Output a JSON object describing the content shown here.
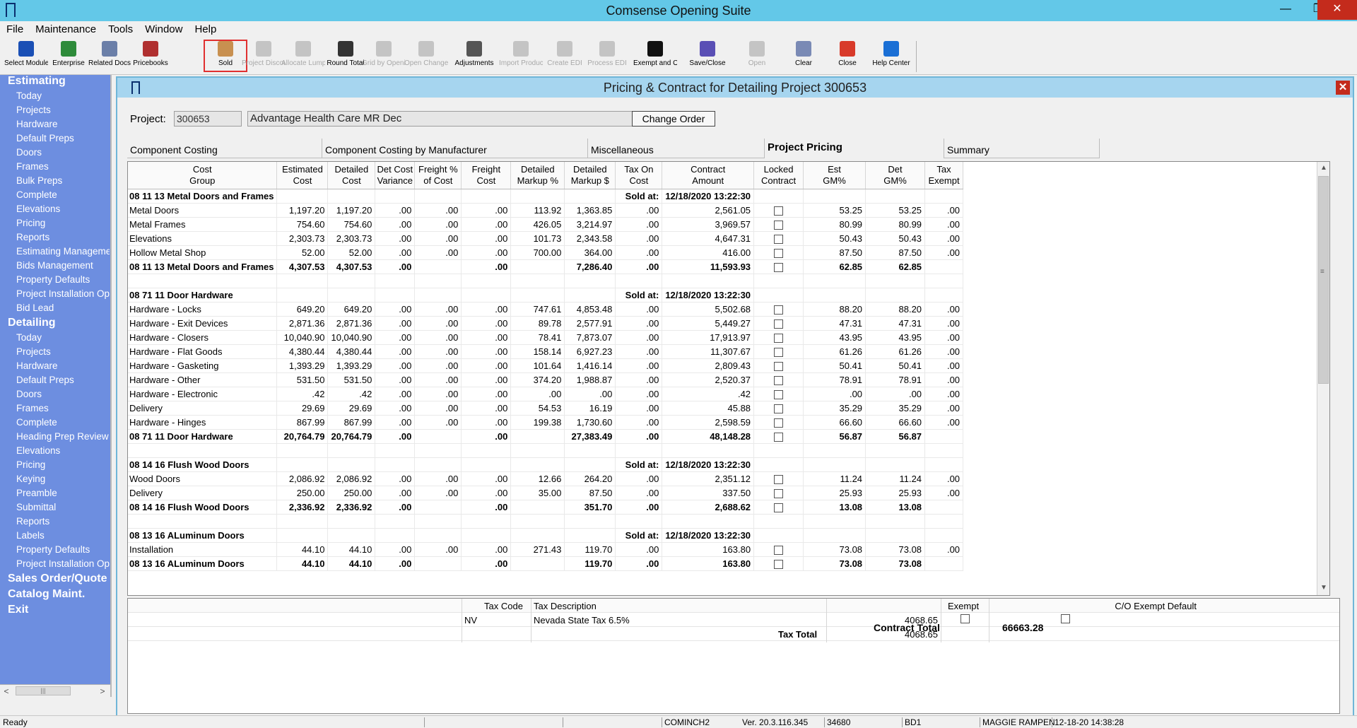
{
  "window": {
    "title": "Comsense Opening Suite"
  },
  "menu": [
    "File",
    "Maintenance",
    "Tools",
    "Window",
    "Help"
  ],
  "toolbar": [
    {
      "label": "Select Module",
      "icon": "module-icon",
      "color": "#1a4fb5",
      "enabled": true
    },
    {
      "label": "Enterprise",
      "icon": "enterprise-icon",
      "color": "#2e8b3a",
      "enabled": true
    },
    {
      "label": "Related Docs",
      "icon": "related-docs-icon",
      "color": "#6b7fa8",
      "enabled": true
    },
    {
      "label": "Pricebooks",
      "icon": "pricebooks-icon",
      "color": "#b03030",
      "enabled": true
    },
    {
      "label": "Sold",
      "icon": "sold-icon",
      "color": "#c89050",
      "enabled": true
    },
    {
      "label": "Project Discount",
      "icon": "discount-icon",
      "color": "#8a8a8a",
      "enabled": false
    },
    {
      "label": "Allocate Lump Sum",
      "icon": "lump-sum-icon",
      "color": "#8a8a8a",
      "enabled": false
    },
    {
      "label": "Round Total",
      "icon": "round-total-icon",
      "color": "#333333",
      "enabled": true
    },
    {
      "label": "Grid by Opening",
      "icon": "binoculars-icon",
      "color": "#8a8a8a",
      "enabled": false
    },
    {
      "label": "Open Change Wizard",
      "icon": "change-icon",
      "color": "#8a8a8a",
      "enabled": false
    },
    {
      "label": "Adjustments",
      "icon": "adjustments-icon",
      "color": "#555555",
      "enabled": true
    },
    {
      "label": "Import Products",
      "icon": "import-icon",
      "color": "#8a8a8a",
      "enabled": false
    },
    {
      "label": "Create EDI",
      "icon": "create-edi-icon",
      "color": "#8a8a8a",
      "enabled": false
    },
    {
      "label": "Process EDI",
      "icon": "process-edi-icon",
      "color": "#8a8a8a",
      "enabled": false
    },
    {
      "label": "Exempt and Or",
      "icon": "percent-icon",
      "color": "#111111",
      "enabled": true
    },
    {
      "label": "Save/Close",
      "icon": "save-icon",
      "color": "#5a4fb5",
      "enabled": true
    },
    {
      "label": "Open",
      "icon": "open-folder-icon",
      "color": "#8a8a8a",
      "enabled": false
    },
    {
      "label": "Clear",
      "icon": "eraser-icon",
      "color": "#7a8ab5",
      "enabled": true
    },
    {
      "label": "Close",
      "icon": "close-icon",
      "color": "#d83a2a",
      "enabled": true
    },
    {
      "label": "Help Center",
      "icon": "help-icon",
      "color": "#1a6fd5",
      "enabled": true
    }
  ],
  "nav": {
    "sections": [
      {
        "title": "Estimating",
        "items": [
          "Today",
          "Projects",
          "Hardware",
          "Default Preps",
          "Doors",
          "Frames",
          "Bulk Preps",
          "Complete",
          "Elevations",
          "Pricing",
          "Reports",
          "Estimating Management",
          "Bids Management",
          "Property Defaults",
          "Project Installation Options",
          "Bid Lead"
        ]
      },
      {
        "title": "Detailing",
        "items": [
          "Today",
          "Projects",
          "Hardware",
          "Default Preps",
          "Doors",
          "Frames",
          "Complete",
          "Heading Prep Review",
          "Elevations",
          "Pricing",
          "Keying",
          "Preamble",
          "Submittal",
          "Reports",
          "Labels",
          "Property Defaults",
          "Project Installation Options"
        ]
      },
      {
        "title": "Sales Order/Quote",
        "items": []
      },
      {
        "title": "Catalog Maint.",
        "items": []
      },
      {
        "title": "Exit",
        "items": []
      }
    ]
  },
  "child": {
    "title": "Pricing & Contract for Detailing Project 300653",
    "project_label": "Project:",
    "project_number": "300653",
    "project_name": "Advantage Health Care MR Dec",
    "change_order_label": "Change Order",
    "tabs": [
      "Component Costing",
      "Component Costing by Manufacturer",
      "Miscellaneous",
      "Project Pricing",
      "Summary"
    ],
    "active_tab": "Project Pricing"
  },
  "grid": {
    "columns": [
      "Cost\nGroup",
      "Estimated\nCost",
      "Detailed\nCost",
      "Det Cost\nVariance",
      "Freight %\nof Cost",
      "Freight\nCost",
      "Detailed\nMarkup %",
      "Detailed\nMarkup $",
      "Tax On\nCost",
      "Contract\nAmount",
      "Locked\nContract",
      "Est\nGM%",
      "Det\nGM%",
      "Tax\nExempt"
    ],
    "rows": [
      {
        "type": "hdr",
        "cells": [
          "08 11 13 Metal Doors and Frames",
          "",
          "",
          "",
          "",
          "",
          "",
          "",
          "Sold at:",
          "12/18/2020 13:22:30",
          "",
          "",
          "",
          ""
        ]
      },
      {
        "type": "row",
        "cells": [
          "Metal Doors",
          "1,197.20",
          "1,197.20",
          ".00",
          ".00",
          ".00",
          "113.92",
          "1,363.85",
          ".00",
          "2,561.05",
          "cb",
          "53.25",
          "53.25",
          ".00"
        ]
      },
      {
        "type": "row",
        "cells": [
          "Metal Frames",
          "754.60",
          "754.60",
          ".00",
          ".00",
          ".00",
          "426.05",
          "3,214.97",
          ".00",
          "3,969.57",
          "cb",
          "80.99",
          "80.99",
          ".00"
        ]
      },
      {
        "type": "row",
        "cells": [
          "Elevations",
          "2,303.73",
          "2,303.73",
          ".00",
          ".00",
          ".00",
          "101.73",
          "2,343.58",
          ".00",
          "4,647.31",
          "cb",
          "50.43",
          "50.43",
          ".00"
        ]
      },
      {
        "type": "row",
        "cells": [
          "Hollow Metal Shop",
          "52.00",
          "52.00",
          ".00",
          ".00",
          ".00",
          "700.00",
          "364.00",
          ".00",
          "416.00",
          "cb",
          "87.50",
          "87.50",
          ".00"
        ]
      },
      {
        "type": "bold",
        "cells": [
          "08 11 13 Metal Doors and Frames",
          "4,307.53",
          "4,307.53",
          ".00",
          "",
          ".00",
          "",
          "7,286.40",
          ".00",
          "11,593.93",
          "cb",
          "62.85",
          "62.85",
          ""
        ]
      },
      {
        "type": "blank",
        "cells": []
      },
      {
        "type": "hdr",
        "cells": [
          "08 71 11 Door Hardware",
          "",
          "",
          "",
          "",
          "",
          "",
          "",
          "Sold at:",
          "12/18/2020 13:22:30",
          "",
          "",
          "",
          ""
        ]
      },
      {
        "type": "row",
        "cells": [
          "Hardware - Locks",
          "649.20",
          "649.20",
          ".00",
          ".00",
          ".00",
          "747.61",
          "4,853.48",
          ".00",
          "5,502.68",
          "cb",
          "88.20",
          "88.20",
          ".00"
        ]
      },
      {
        "type": "row",
        "cells": [
          "Hardware - Exit Devices",
          "2,871.36",
          "2,871.36",
          ".00",
          ".00",
          ".00",
          "89.78",
          "2,577.91",
          ".00",
          "5,449.27",
          "cb",
          "47.31",
          "47.31",
          ".00"
        ]
      },
      {
        "type": "row",
        "cells": [
          "Hardware - Closers",
          "10,040.90",
          "10,040.90",
          ".00",
          ".00",
          ".00",
          "78.41",
          "7,873.07",
          ".00",
          "17,913.97",
          "cb",
          "43.95",
          "43.95",
          ".00"
        ]
      },
      {
        "type": "row",
        "cells": [
          "Hardware - Flat Goods",
          "4,380.44",
          "4,380.44",
          ".00",
          ".00",
          ".00",
          "158.14",
          "6,927.23",
          ".00",
          "11,307.67",
          "cb",
          "61.26",
          "61.26",
          ".00"
        ]
      },
      {
        "type": "row",
        "cells": [
          "Hardware - Gasketing",
          "1,393.29",
          "1,393.29",
          ".00",
          ".00",
          ".00",
          "101.64",
          "1,416.14",
          ".00",
          "2,809.43",
          "cb",
          "50.41",
          "50.41",
          ".00"
        ]
      },
      {
        "type": "row",
        "cells": [
          "Hardware - Other",
          "531.50",
          "531.50",
          ".00",
          ".00",
          ".00",
          "374.20",
          "1,988.87",
          ".00",
          "2,520.37",
          "cb",
          "78.91",
          "78.91",
          ".00"
        ]
      },
      {
        "type": "row",
        "cells": [
          "Hardware - Electronic",
          ".42",
          ".42",
          ".00",
          ".00",
          ".00",
          ".00",
          ".00",
          ".00",
          ".42",
          "cb",
          ".00",
          ".00",
          ".00"
        ]
      },
      {
        "type": "row",
        "cells": [
          "Delivery",
          "29.69",
          "29.69",
          ".00",
          ".00",
          ".00",
          "54.53",
          "16.19",
          ".00",
          "45.88",
          "cb",
          "35.29",
          "35.29",
          ".00"
        ]
      },
      {
        "type": "row",
        "cells": [
          "Hardware - Hinges",
          "867.99",
          "867.99",
          ".00",
          ".00",
          ".00",
          "199.38",
          "1,730.60",
          ".00",
          "2,598.59",
          "cb",
          "66.60",
          "66.60",
          ".00"
        ]
      },
      {
        "type": "bold",
        "cells": [
          "08 71 11 Door Hardware",
          "20,764.79",
          "20,764.79",
          ".00",
          "",
          ".00",
          "",
          "27,383.49",
          ".00",
          "48,148.28",
          "cb",
          "56.87",
          "56.87",
          ""
        ]
      },
      {
        "type": "blank",
        "cells": []
      },
      {
        "type": "hdr",
        "cells": [
          "08 14 16 Flush Wood Doors",
          "",
          "",
          "",
          "",
          "",
          "",
          "",
          "Sold at:",
          "12/18/2020 13:22:30",
          "",
          "",
          "",
          ""
        ]
      },
      {
        "type": "row",
        "cells": [
          "Wood Doors",
          "2,086.92",
          "2,086.92",
          ".00",
          ".00",
          ".00",
          "12.66",
          "264.20",
          ".00",
          "2,351.12",
          "cb",
          "11.24",
          "11.24",
          ".00"
        ]
      },
      {
        "type": "row",
        "cells": [
          "Delivery",
          "250.00",
          "250.00",
          ".00",
          ".00",
          ".00",
          "35.00",
          "87.50",
          ".00",
          "337.50",
          "cb",
          "25.93",
          "25.93",
          ".00"
        ]
      },
      {
        "type": "bold",
        "cells": [
          "08 14 16 Flush Wood Doors",
          "2,336.92",
          "2,336.92",
          ".00",
          "",
          ".00",
          "",
          "351.70",
          ".00",
          "2,688.62",
          "cb",
          "13.08",
          "13.08",
          ""
        ]
      },
      {
        "type": "blank",
        "cells": []
      },
      {
        "type": "hdr",
        "cells": [
          "08 13 16 ALuminum Doors",
          "",
          "",
          "",
          "",
          "",
          "",
          "",
          "Sold at:",
          "12/18/2020 13:22:30",
          "",
          "",
          "",
          ""
        ]
      },
      {
        "type": "row",
        "cells": [
          "Installation",
          "44.10",
          "44.10",
          ".00",
          ".00",
          ".00",
          "271.43",
          "119.70",
          ".00",
          "163.80",
          "cb",
          "73.08",
          "73.08",
          ".00"
        ]
      },
      {
        "type": "bold",
        "cells": [
          "08 13 16 ALuminum Doors",
          "44.10",
          "44.10",
          ".00",
          "",
          ".00",
          "",
          "119.70",
          ".00",
          "163.80",
          "cb",
          "73.08",
          "73.08",
          ""
        ]
      }
    ]
  },
  "tax": {
    "headers": {
      "code": "Tax Code",
      "description": "Tax Description",
      "exempt": "Exempt",
      "co_exempt": "C/O Exempt Default"
    },
    "rows": [
      {
        "code": "NV",
        "description": "Nevada State Tax 6.5%",
        "amount": "4068.65"
      }
    ],
    "total_label": "Tax Total",
    "total_value": "4068.65"
  },
  "contract_total_label": "Contract Total",
  "contract_total_value": "66663.28",
  "status": {
    "ready": "Ready",
    "server": "COMINCH2",
    "version": "Ver. 20.3.116.345",
    "code": "34680",
    "db": "BD1",
    "user": "MAGGIE RAMPEN",
    "timestamp": "12-18-20 14:38:28"
  }
}
